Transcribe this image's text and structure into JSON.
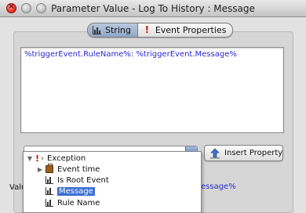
{
  "window": {
    "title": "Parameter Value - Log To History : Message"
  },
  "tabs": [
    {
      "label": "String",
      "icon": "bar-chart-icon",
      "active": true
    },
    {
      "label": "Event Properties",
      "icon": "exclamation-icon",
      "active": false
    }
  ],
  "editor": {
    "value": "%triggerEvent.RuleName%: %triggerEvent.Message%"
  },
  "insert_button": {
    "label": "Insert Property",
    "icon": "insert-arrow-icon"
  },
  "bottom": {
    "label": "Valu",
    "value": "essage%"
  },
  "popup": {
    "root": {
      "label": "Exception",
      "marker": "›"
    },
    "items": [
      {
        "label": "Event time",
        "icon": "briefcase-icon",
        "expandable": true,
        "selected": false
      },
      {
        "label": "Is Root Event",
        "icon": "bar-chart-icon",
        "expandable": false,
        "selected": false
      },
      {
        "label": "Message",
        "icon": "bar-chart-icon",
        "expandable": false,
        "selected": true
      },
      {
        "label": "Rule Name",
        "icon": "bar-chart-icon",
        "expandable": false,
        "selected": false
      }
    ]
  },
  "colors": {
    "accent": "#3b6ed3",
    "variable_text": "#2a2ad0",
    "close_button": "#d9221c"
  }
}
